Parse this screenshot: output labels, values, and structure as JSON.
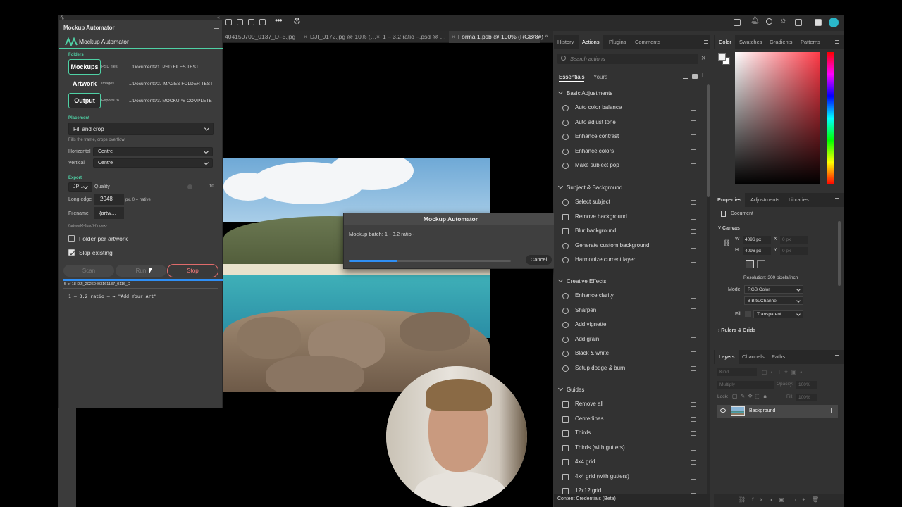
{
  "doc_tabs": [
    {
      "label": "404150709_0137_D–5.jpg",
      "active": false
    },
    {
      "label": "DJI_0172.jpg @ 10% (…",
      "active": false
    },
    {
      "label": "1 – 3.2 ratio –.psd @ …",
      "active": false
    },
    {
      "label": "Forma 1.psb @ 100% (RGB/8#)",
      "active": true
    }
  ],
  "mockup_panel": {
    "title": "Mockup Automator",
    "logo_text": "Mockup Automator",
    "folders_label": "Folders",
    "rows": [
      {
        "button": "Mockups",
        "kind": "PSD files",
        "path": "../Documents/1. PSD FILES TEST"
      },
      {
        "button": "Artwork",
        "kind": "Images",
        "path": "../Documents/2. IMAGES FOLDER TEST"
      },
      {
        "button": "Output",
        "kind": "Exports to",
        "path": "../Documents/3. MOCKUPS COMPLETE"
      }
    ],
    "placement_label": "Placement",
    "placement_value": "Fill and crop",
    "placement_hint": "Fills the frame, crops overflow.",
    "horizontal_label": "Horizontal",
    "horizontal_value": "Centre",
    "vertical_label": "Vertical",
    "vertical_value": "Centre",
    "export_label": "Export",
    "format_value": "JP…",
    "quality_label": "Quality",
    "quality_value": "10",
    "long_edge_label": "Long edge",
    "long_edge_value": "2048",
    "long_edge_hint": "px, 0 = native",
    "filename_label": "Filename",
    "filename_value": "{artw…",
    "filename_hint": "{artwork}-{psd}-{index}",
    "folder_per_artwork": "Folder per artwork",
    "skip_existing": "Skip existing",
    "scan": "Scan",
    "run": "Run",
    "stop": "Stop",
    "progress": 1.0,
    "status": "5 of 18 DJI_20260403161137_0116_D",
    "log": "1 – 3.2 ratio –  →  \"Add Your Art\""
  },
  "dialog": {
    "title": "Mockup Automator",
    "message": "Mockup batch: 1 - 3.2 ratio -",
    "progress": 0.3,
    "cancel": "Cancel"
  },
  "actions_panel": {
    "tabs": [
      "History",
      "Actions",
      "Plugins",
      "Comments"
    ],
    "active_tab": "Actions",
    "search_placeholder": "Search actions",
    "segments": [
      "Essentials",
      "Yours"
    ],
    "groups": [
      {
        "name": "Basic Adjustments",
        "items": [
          "Auto color balance",
          "Auto adjust tone",
          "Enhance contrast",
          "Enhance colors",
          "Make subject pop"
        ]
      },
      {
        "name": "Subject & Background",
        "items": [
          "Select subject",
          "Remove background",
          "Blur background",
          "Generate custom background",
          "Harmonize current layer"
        ]
      },
      {
        "name": "Creative Effects",
        "items": [
          "Enhance clarity",
          "Sharpen",
          "Add vignette",
          "Add grain",
          "Black & white",
          "Setup dodge & burn"
        ]
      },
      {
        "name": "Guides",
        "items": [
          "Remove all",
          "Centerlines",
          "Thirds",
          "Thirds (with gutters)",
          "4x4 grid",
          "4x4 grid (with gutters)",
          "12x12 grid"
        ]
      }
    ],
    "footer": "Content Credentials (Beta)"
  },
  "color_panel": {
    "tabs": [
      "Color",
      "Swatches",
      "Gradients",
      "Patterns"
    ],
    "colors": {
      "foreground": "#f2f2f2",
      "hue": "#ff3b48"
    }
  },
  "properties_panel": {
    "tabs": [
      "Properties",
      "Adjustments",
      "Libraries"
    ],
    "document_label": "Document",
    "canvas_label": "Canvas",
    "w_label": "W",
    "w_value": "4096 px",
    "h_label": "H",
    "h_value": "4096 px",
    "x_label": "X",
    "x_value": "0 px",
    "y_label": "Y",
    "y_value": "0 px",
    "resolution": "Resolution: 300 pixels/inch",
    "mode_label": "Mode",
    "mode_value": "RGB Color",
    "bits_value": "8 Bits/Channel",
    "fill_label": "Fill",
    "fill_value": "Transparent",
    "rulers_label": "Rulers & Grids"
  },
  "layers_panel": {
    "tabs": [
      "Layers",
      "Channels",
      "Paths"
    ],
    "kind_placeholder": "Kind",
    "blend_value": "Multiply",
    "opacity_label": "Opacity:",
    "opacity_value": "100%",
    "lock_label": "Lock:",
    "fill_label": "Fill:",
    "fill_value": "100%",
    "layer_name": "Background"
  }
}
